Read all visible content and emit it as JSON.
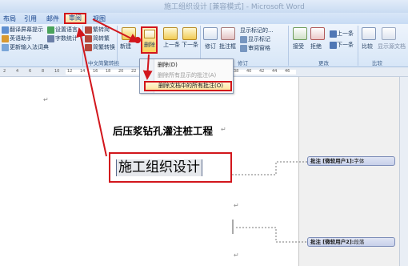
{
  "window": {
    "title": "施工组织设计 [兼容模式] - Microsoft Word"
  },
  "tabs": [
    {
      "label": "布局"
    },
    {
      "label": "引用"
    },
    {
      "label": "邮件"
    },
    {
      "label": "审阅",
      "active": true
    },
    {
      "label": "视图"
    }
  ],
  "ribbon": {
    "proofing": {
      "items": [
        "翻译屏幕提示",
        "设置语言",
        "英语助手",
        "字数统计",
        "更新输入法词典"
      ],
      "group_label": ""
    },
    "chinese": {
      "items": [
        "繁转简",
        "简转繁",
        "简繁转换"
      ],
      "group_label": "中文简繁转换"
    },
    "comments": {
      "new_label": "新建",
      "delete_label": "删除",
      "prev_label": "上一条",
      "next_label": "下一条"
    },
    "tracking": {
      "track_label": "修订",
      "balloons_label": "批注框",
      "show_markup_label": "显示标记的...",
      "show_markup2_label": "显示标记",
      "review_pane_label": "审阅窗格",
      "group_label": "修订"
    },
    "changes": {
      "accept_label": "接受",
      "reject_label": "拒绝",
      "prev_label": "上一条",
      "next_label": "下一条",
      "group_label": "更改"
    },
    "compare": {
      "compare_label": "比较",
      "show_source_label": "显示源文档",
      "group_label": "比较"
    }
  },
  "delete_menu": {
    "items": [
      {
        "label": "删除(D)",
        "enabled": true
      },
      {
        "label": "删除所有显示的批注(A)",
        "enabled": false
      },
      {
        "label": "删除文档中的所有批注(O)",
        "enabled": true,
        "highlighted": true
      }
    ]
  },
  "ruler": {
    "numbers": [
      "2",
      "4",
      "6",
      "8",
      "10",
      "12",
      "14",
      "16",
      "18",
      "20",
      "22",
      "24",
      "26",
      "28",
      "30",
      "32",
      "34",
      "36",
      "38",
      "40",
      "42",
      "44",
      "46"
    ]
  },
  "document": {
    "heading": "后压浆钻孔灌注桩工程",
    "big_title": "施工组织设计",
    "pilcrow": "↵"
  },
  "comments": [
    {
      "prefix": "批注 [微软用户1]:",
      "text": "字体"
    },
    {
      "prefix": "批注 [微软用户2]:",
      "text": "段落"
    }
  ],
  "colors": {
    "highlight_red": "#d2161c",
    "ribbon_blue": "#1e395b",
    "comment_fill": "#c7d0ea"
  }
}
